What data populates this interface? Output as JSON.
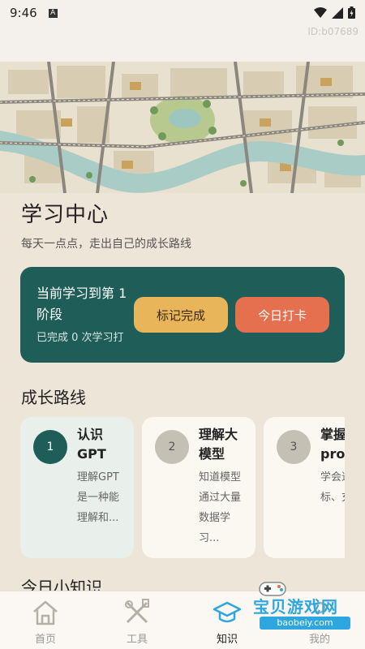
{
  "status_bar": {
    "time": "9:46",
    "notification_icon": "A"
  },
  "id_label": "ID:b07689",
  "header": {
    "title": "学习中心",
    "subtitle": "每天一点点，走出自己的成长路线"
  },
  "progress_card": {
    "current_stage": "当前学习到第 1 阶段",
    "done_text": "已完成 0 次学习打",
    "mark_done_label": "标记完成",
    "checkin_label": "今日打卡"
  },
  "growth_path": {
    "title": "成长路线",
    "items": [
      {
        "num": "1",
        "name": "认识GPT",
        "desc": "理解GPT是一种能理解和..."
      },
      {
        "num": "2",
        "name": "理解大模型",
        "desc": "知道模型通过大量数据学习..."
      },
      {
        "num": "3",
        "name": "掌握prom",
        "desc": "学会述目标、充背"
      }
    ]
  },
  "tips": {
    "title": "今日小知识"
  },
  "bottom_nav": {
    "items": [
      {
        "label": "首页",
        "icon": "home-icon"
      },
      {
        "label": "工具",
        "icon": "tools-icon"
      },
      {
        "label": "知识",
        "icon": "knowledge-icon"
      },
      {
        "label": "我的",
        "icon": "profile-icon"
      }
    ]
  },
  "watermark": {
    "text": "宝贝游戏网",
    "url": "baobeiy.com"
  },
  "colors": {
    "background": "#ede5d8",
    "progress_card": "#1f5e58",
    "mark_button": "#e8b55a",
    "checkin_button": "#e4704f",
    "watermark": "#2ea7e0"
  }
}
